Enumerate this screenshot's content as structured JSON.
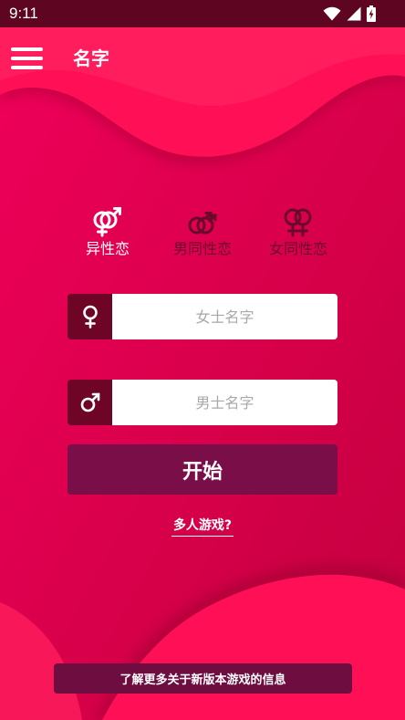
{
  "status_bar": {
    "time": "9:11",
    "icons": [
      "wifi-icon",
      "signal-icon",
      "battery-charging-icon"
    ]
  },
  "header": {
    "title": "名字",
    "menu_icon": "hamburger-menu-icon"
  },
  "modes": [
    {
      "label": "异性恋",
      "icon": "hetero-gender-icon",
      "selected": true
    },
    {
      "label": "男同性恋",
      "icon": "gay-gender-icon",
      "selected": false
    },
    {
      "label": "女同性恋",
      "icon": "lesbian-gender-icon",
      "selected": false
    }
  ],
  "inputs": {
    "female": {
      "placeholder": "女士名字",
      "value": "",
      "icon": "female-symbol-icon"
    },
    "male": {
      "placeholder": "男士名字",
      "value": "",
      "icon": "male-symbol-icon"
    }
  },
  "start_button": {
    "label": "开始"
  },
  "multiplayer_link": {
    "label": "多人游戏?"
  },
  "info_button": {
    "label": "了解更多关于新版本游戏的信息"
  },
  "colors": {
    "background": "#e5004f",
    "status_bar": "#5e0522",
    "icon_box": "#6e0527",
    "start_button": "#7a0e48",
    "info_button": "#6e0d40",
    "mode_selected": "#ffffff",
    "mode_unselected": "#6a0a2b"
  }
}
